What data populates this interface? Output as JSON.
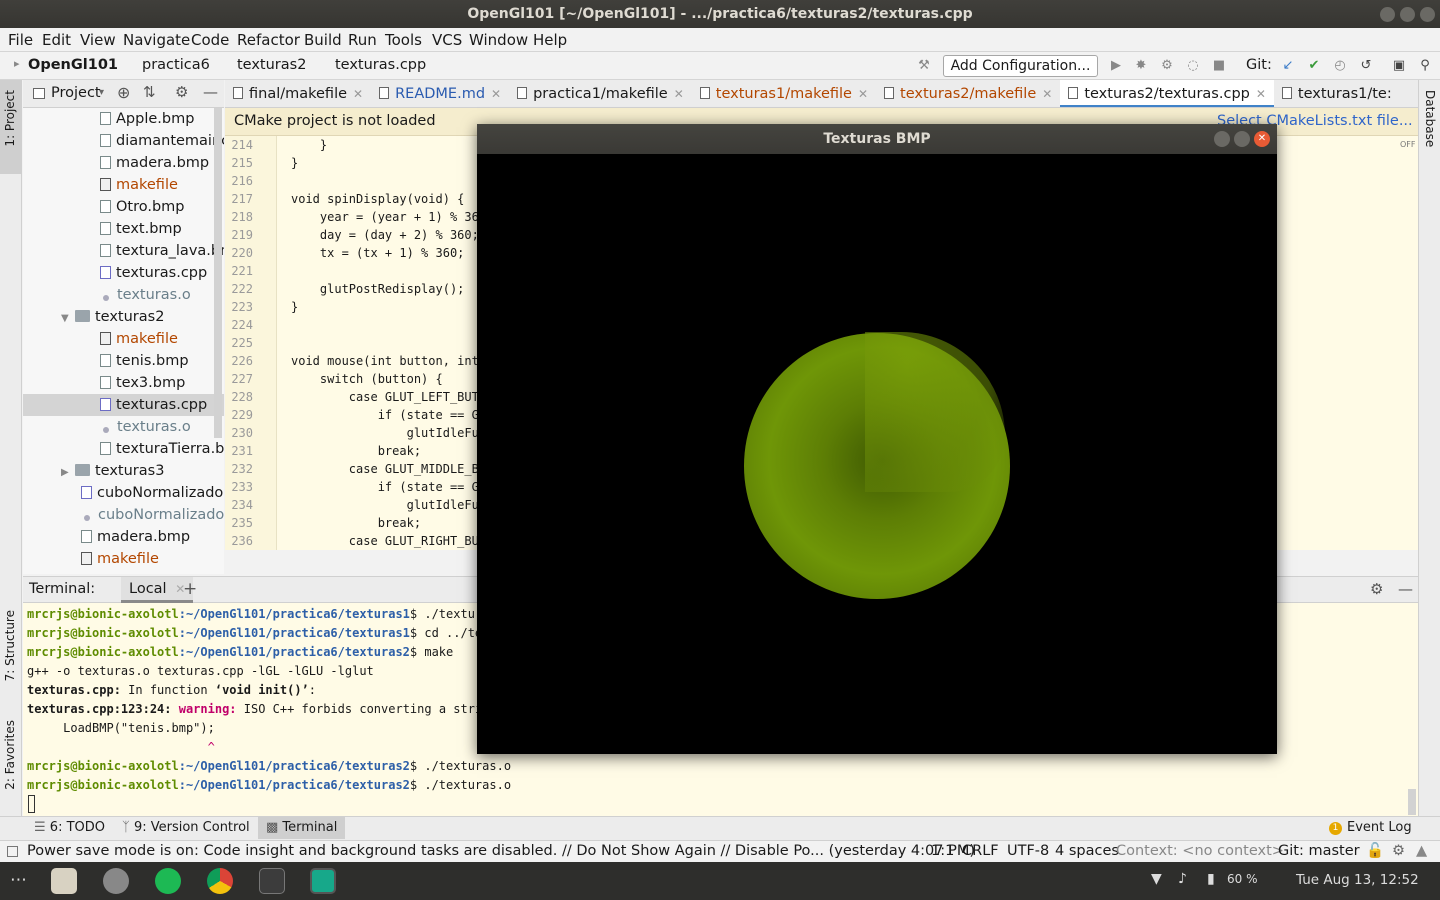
{
  "window": {
    "title": "OpenGl101 [~/OpenGl101] - .../practica6/texturas2/texturas.cpp"
  },
  "menu": [
    "File",
    "Edit",
    "View",
    "Navigate",
    "Code",
    "Refactor",
    "Build",
    "Run",
    "Tools",
    "VCS",
    "Window",
    "Help"
  ],
  "breadcrumb": {
    "project": "OpenGl101",
    "c1": "practica6",
    "c2": "texturas2",
    "file": "texturas.cpp"
  },
  "toolbar": {
    "add_config": "Add Configuration...",
    "git_label": "Git:"
  },
  "sidebar_left": {
    "project": "1: Project",
    "structure": "7: Structure",
    "favorites": "2: Favorites"
  },
  "sidebar_right": {
    "database": "Database"
  },
  "project_panel": {
    "header": "Project",
    "items": [
      {
        "name": "Apple.bmp",
        "kind": "file"
      },
      {
        "name": "diamantemaincra",
        "kind": "file"
      },
      {
        "name": "madera.bmp",
        "kind": "file"
      },
      {
        "name": "makefile",
        "kind": "make"
      },
      {
        "name": "Otro.bmp",
        "kind": "file"
      },
      {
        "name": "text.bmp",
        "kind": "file"
      },
      {
        "name": "textura_lava.bmp",
        "kind": "file"
      },
      {
        "name": "texturas.cpp",
        "kind": "cpp"
      },
      {
        "name": "texturas.o",
        "kind": "obj"
      },
      {
        "name": "texturas2",
        "kind": "dir"
      },
      {
        "name": "makefile",
        "kind": "make"
      },
      {
        "name": "tenis.bmp",
        "kind": "file"
      },
      {
        "name": "tex3.bmp",
        "kind": "file"
      },
      {
        "name": "texturas.cpp",
        "kind": "cpp"
      },
      {
        "name": "texturas.o",
        "kind": "obj"
      },
      {
        "name": "texturaTierra.bmp",
        "kind": "file"
      },
      {
        "name": "texturas3",
        "kind": "dir"
      },
      {
        "name": "cuboNormalizado.cpp",
        "kind": "cpp"
      },
      {
        "name": "cuboNormalizado.o",
        "kind": "obj"
      },
      {
        "name": "madera.bmp",
        "kind": "file"
      },
      {
        "name": "makefile",
        "kind": "make"
      }
    ]
  },
  "tabs": [
    "final/makefile",
    "README.md",
    "practica1/makefile",
    "texturas1/makefile",
    "texturas2/makefile",
    "texturas2/texturas.cpp",
    "texturas1/te:"
  ],
  "notice": {
    "text": "CMake project is not loaded",
    "link": "Select CMakeLists.txt file..."
  },
  "editor": {
    "lines": [
      {
        "n": "214",
        "code": "    }"
      },
      {
        "n": "215",
        "code": "}"
      },
      {
        "n": "216",
        "code": ""
      },
      {
        "n": "217",
        "code": "void spinDisplay(void) {"
      },
      {
        "n": "218",
        "code": "    year = (year + 1) % 360"
      },
      {
        "n": "219",
        "code": "    day = (day + 2) % 360;"
      },
      {
        "n": "220",
        "code": "    tx = (tx + 1) % 360;"
      },
      {
        "n": "221",
        "code": ""
      },
      {
        "n": "222",
        "code": "    glutPostRedisplay();"
      },
      {
        "n": "223",
        "code": "}"
      },
      {
        "n": "224",
        "code": ""
      },
      {
        "n": "225",
        "code": ""
      },
      {
        "n": "226",
        "code": "void mouse(int button, int"
      },
      {
        "n": "227",
        "code": "    switch (button) {"
      },
      {
        "n": "228",
        "code": "        case GLUT_LEFT_BUTT"
      },
      {
        "n": "229",
        "code": "            if (state == GL"
      },
      {
        "n": "230",
        "code": "                glutIdleFun"
      },
      {
        "n": "231",
        "code": "            break;"
      },
      {
        "n": "232",
        "code": "        case GLUT_MIDDLE_BU"
      },
      {
        "n": "233",
        "code": "            if (state == GL"
      },
      {
        "n": "234",
        "code": "                glutIdleFun"
      },
      {
        "n": "235",
        "code": "            break;"
      },
      {
        "n": "236",
        "code": "        case GLUT_RIGHT_BUT"
      }
    ],
    "off_label": "OFF"
  },
  "terminal": {
    "title": "Terminal:",
    "tab": "Local",
    "lines": [
      {
        "user": "mrcrjs@bionic-axolotl",
        "path": ":~/OpenGl101/practica6/texturas1",
        "cmd": "$ ./texturas"
      },
      {
        "user": "mrcrjs@bionic-axolotl",
        "path": ":~/OpenGl101/practica6/texturas1",
        "cmd": "$ cd ../tex"
      },
      {
        "user": "mrcrjs@bionic-axolotl",
        "path": ":~/OpenGl101/practica6/texturas2",
        "cmd": "$ make"
      },
      {
        "plain": "g++ -o texturas.o texturas.cpp -lGL -lGLU -lglut"
      },
      {
        "bold": "texturas.cpp:",
        "rest": " In function ",
        "quoted": "‘void init()’",
        "end": ":"
      },
      {
        "bold": "texturas.cpp:123:24:",
        "warn": " warning:",
        "rest": " ISO C++ forbids converting a string"
      },
      {
        "plain": "     LoadBMP(\"tenis.bmp\");"
      },
      {
        "caret": "                         ^"
      },
      {
        "user": "mrcrjs@bionic-axolotl",
        "path": ":~/OpenGl101/practica6/texturas2",
        "cmd": "$ ./texturas.o"
      },
      {
        "user": "mrcrjs@bionic-axolotl",
        "path": ":~/OpenGl101/practica6/texturas2",
        "cmd": "$ ./texturas.o"
      }
    ]
  },
  "bottom_tools": {
    "todo": "6: TODO",
    "vcs": "9: Version Control",
    "terminal": "Terminal",
    "event_log": "Event Log",
    "event_count": "1"
  },
  "status": {
    "message": "Power save mode is on: Code insight and background tasks are disabled. // Do Not Show Again // Disable Po... (yesterday 4:07 PM)",
    "position": "1:1",
    "line_sep": "CRLF",
    "encoding": "UTF-8",
    "indent": "4 spaces",
    "context": "Context: <no context>",
    "git": "Git: master"
  },
  "gl_window": {
    "title": "Texturas BMP"
  },
  "dock": {
    "battery": "60 %",
    "clock": "Tue Aug 13, 12:52"
  },
  "colors": {
    "accent": "#4083c9",
    "sphere": "#6f9607",
    "editor_bg": "#fffbe6"
  }
}
